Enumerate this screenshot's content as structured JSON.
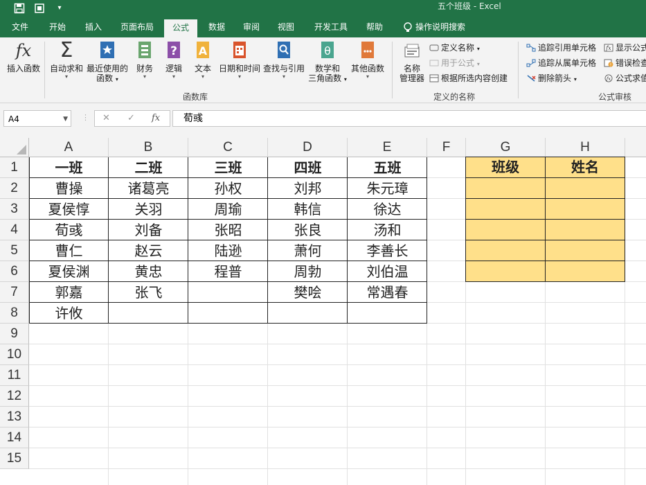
{
  "window": {
    "title": "五个班级  -  Excel"
  },
  "ribbon_tabs": [
    "文件",
    "开始",
    "插入",
    "页面布局",
    "公式",
    "数据",
    "审阅",
    "视图",
    "开发工具",
    "帮助",
    "操作说明搜索"
  ],
  "active_tab": "公式",
  "function_library": {
    "insert_function": "插入函数",
    "autosum": "自动求和",
    "recently_used": [
      "最近使用的",
      "函数"
    ],
    "financial": "财务",
    "logical": "逻辑",
    "text": "文本",
    "datetime": "日期和时间",
    "lookup": "查找与引用",
    "math": [
      "数学和",
      "三角函数"
    ],
    "more": "其他函数",
    "group_label": "函数库"
  },
  "defined_names": {
    "name_manager": [
      "名称",
      "管理器"
    ],
    "define_name": "定义名称",
    "use_in_formula": "用于公式",
    "create_from_selection": "根据所选内容创建",
    "group_label": "定义的名称"
  },
  "formula_auditing": {
    "trace_precedents": "追踪引用单元格",
    "trace_dependents": "追踪从属单元格",
    "remove_arrows": "删除箭头",
    "show_formulas": "显示公式",
    "error_checking": "错误检查",
    "evaluate_formula": "公式求值",
    "group_label": "公式审核"
  },
  "formula_bar": {
    "name_box": "A4",
    "content": "荀彧",
    "fx": "fx"
  },
  "columns": [
    "A",
    "B",
    "C",
    "D",
    "E",
    "F",
    "G",
    "H"
  ],
  "rows": [
    "1",
    "2",
    "3",
    "4",
    "5",
    "6",
    "7",
    "8",
    "9",
    "10",
    "11",
    "12",
    "13",
    "14",
    "15"
  ],
  "colors": {
    "excel_green": "#217346",
    "header_fill": "#ffe08a"
  },
  "sheet": {
    "headers": [
      "一班",
      "二班",
      "三班",
      "四班",
      "五班"
    ],
    "data": [
      [
        "曹操",
        "诸葛亮",
        "孙权",
        "刘邦",
        "朱元璋"
      ],
      [
        "夏侯惇",
        "关羽",
        "周瑜",
        "韩信",
        "徐达"
      ],
      [
        "荀彧",
        "刘备",
        "张昭",
        "张良",
        "汤和"
      ],
      [
        "曹仁",
        "赵云",
        "陆逊",
        "萧何",
        "李善长"
      ],
      [
        "夏侯渊",
        "黄忠",
        "程普",
        "周勃",
        "刘伯温"
      ],
      [
        "郭嘉",
        "张飞",
        "",
        "樊哙",
        "常遇春"
      ],
      [
        "许攸",
        "",
        "",
        "",
        ""
      ]
    ],
    "lookup_headers": [
      "班级",
      "姓名"
    ]
  }
}
